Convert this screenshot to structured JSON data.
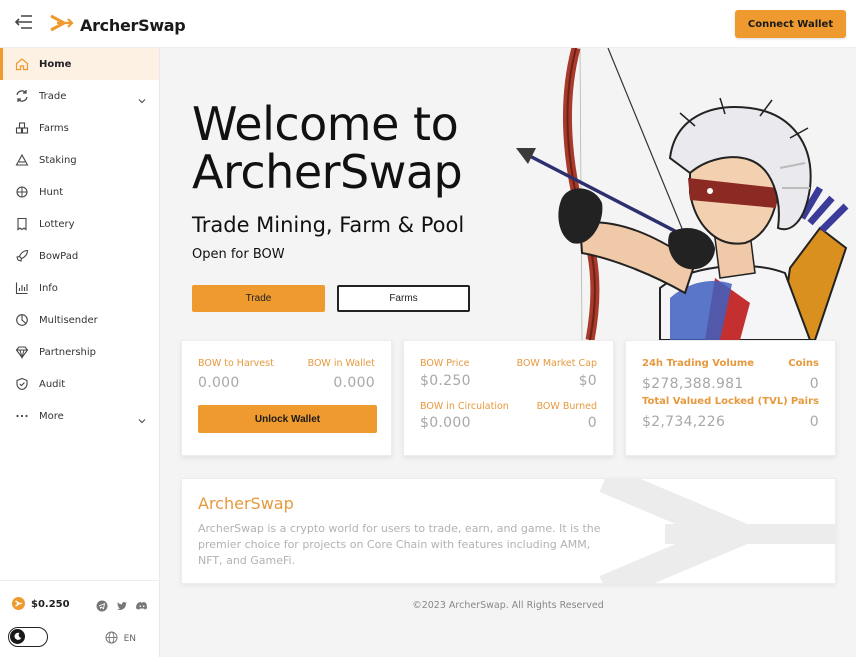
{
  "app": {
    "name": "ArcherSwap"
  },
  "header": {
    "connect_label": "Connect Wallet"
  },
  "sidebar": {
    "items": [
      {
        "label": "Home",
        "icon": "home-icon",
        "active": true
      },
      {
        "label": "Trade",
        "icon": "swap-icon",
        "expandable": true
      },
      {
        "label": "Farms",
        "icon": "farms-icon"
      },
      {
        "label": "Staking",
        "icon": "staking-icon"
      },
      {
        "label": "Hunt",
        "icon": "target-icon"
      },
      {
        "label": "Lottery",
        "icon": "ticket-icon"
      },
      {
        "label": "BowPad",
        "icon": "rocket-icon"
      },
      {
        "label": "Info",
        "icon": "chart-icon"
      },
      {
        "label": "Multisender",
        "icon": "pie-icon"
      },
      {
        "label": "Partnership",
        "icon": "diamond-icon"
      },
      {
        "label": "Audit",
        "icon": "shield-icon"
      },
      {
        "label": "More",
        "icon": "more-icon",
        "expandable": true
      }
    ],
    "bow_price": "$0.250",
    "language": "EN"
  },
  "hero": {
    "title_line1": "Welcome to",
    "title_line2": "ArcherSwap",
    "subtitle": "Trade Mining, Farm & Pool",
    "open_text": "Open for BOW",
    "trade_label": "Trade",
    "farms_label": "Farms"
  },
  "cards": {
    "harvest": {
      "bow_to_harvest_label": "BOW to Harvest",
      "bow_to_harvest_value": "0.000",
      "bow_in_wallet_label": "BOW in Wallet",
      "bow_in_wallet_value": "0.000",
      "unlock_label": "Unlock Wallet"
    },
    "price": {
      "bow_price_label": "BOW Price",
      "bow_price_value": "$0.250",
      "market_cap_label": "BOW Market Cap",
      "market_cap_value": "$0",
      "circulation_label": "BOW in Circulation",
      "circulation_value": "$0.000",
      "burned_label": "BOW Burned",
      "burned_value": "0"
    },
    "volume": {
      "volume_label": "24h Trading Volume",
      "volume_value": "$278,388.981",
      "coins_label": "Coins",
      "coins_value": "0",
      "tvl_label": "Total Valued Locked (TVL)",
      "tvl_value": "$2,734,226",
      "pairs_label": "Pairs",
      "pairs_value": "0"
    }
  },
  "about": {
    "title": "ArcherSwap",
    "text": "ArcherSwap is a crypto world for users to trade, earn, and game. It is the premier choice for projects on Core Chain with features including AMM, NFT, and GameFi."
  },
  "footer": {
    "copyright": "©2023 ArcherSwap. All Rights Reserved"
  },
  "colors": {
    "accent": "#ee9a2e",
    "accent_text": "#e6993d",
    "active_bg": "#fdf1e3"
  }
}
